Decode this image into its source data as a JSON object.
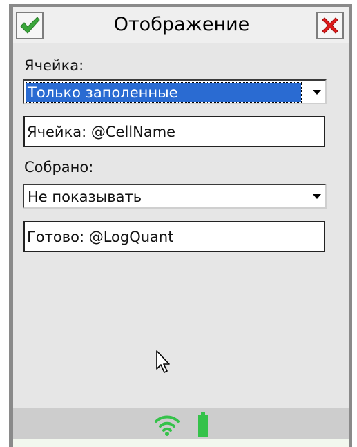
{
  "window": {
    "title": "Отображение",
    "ok_icon": "checkmark-icon",
    "close_icon": "close-x-icon"
  },
  "cell": {
    "label": "Ячейка:",
    "mode_selected": "Только заполенные",
    "format_value": "Ячейка: @CellName"
  },
  "collected": {
    "label": "Собрано:",
    "mode_selected": "Не показывать",
    "format_value": "Готово: @LogQuant"
  },
  "status_bar": {
    "icons": [
      "wifi-icon",
      "battery-icon"
    ]
  },
  "colors": {
    "selection": "#2a6bd2",
    "ok_green": "#3aa63a",
    "close_red": "#e01b1b",
    "status_green": "#35c24a"
  }
}
